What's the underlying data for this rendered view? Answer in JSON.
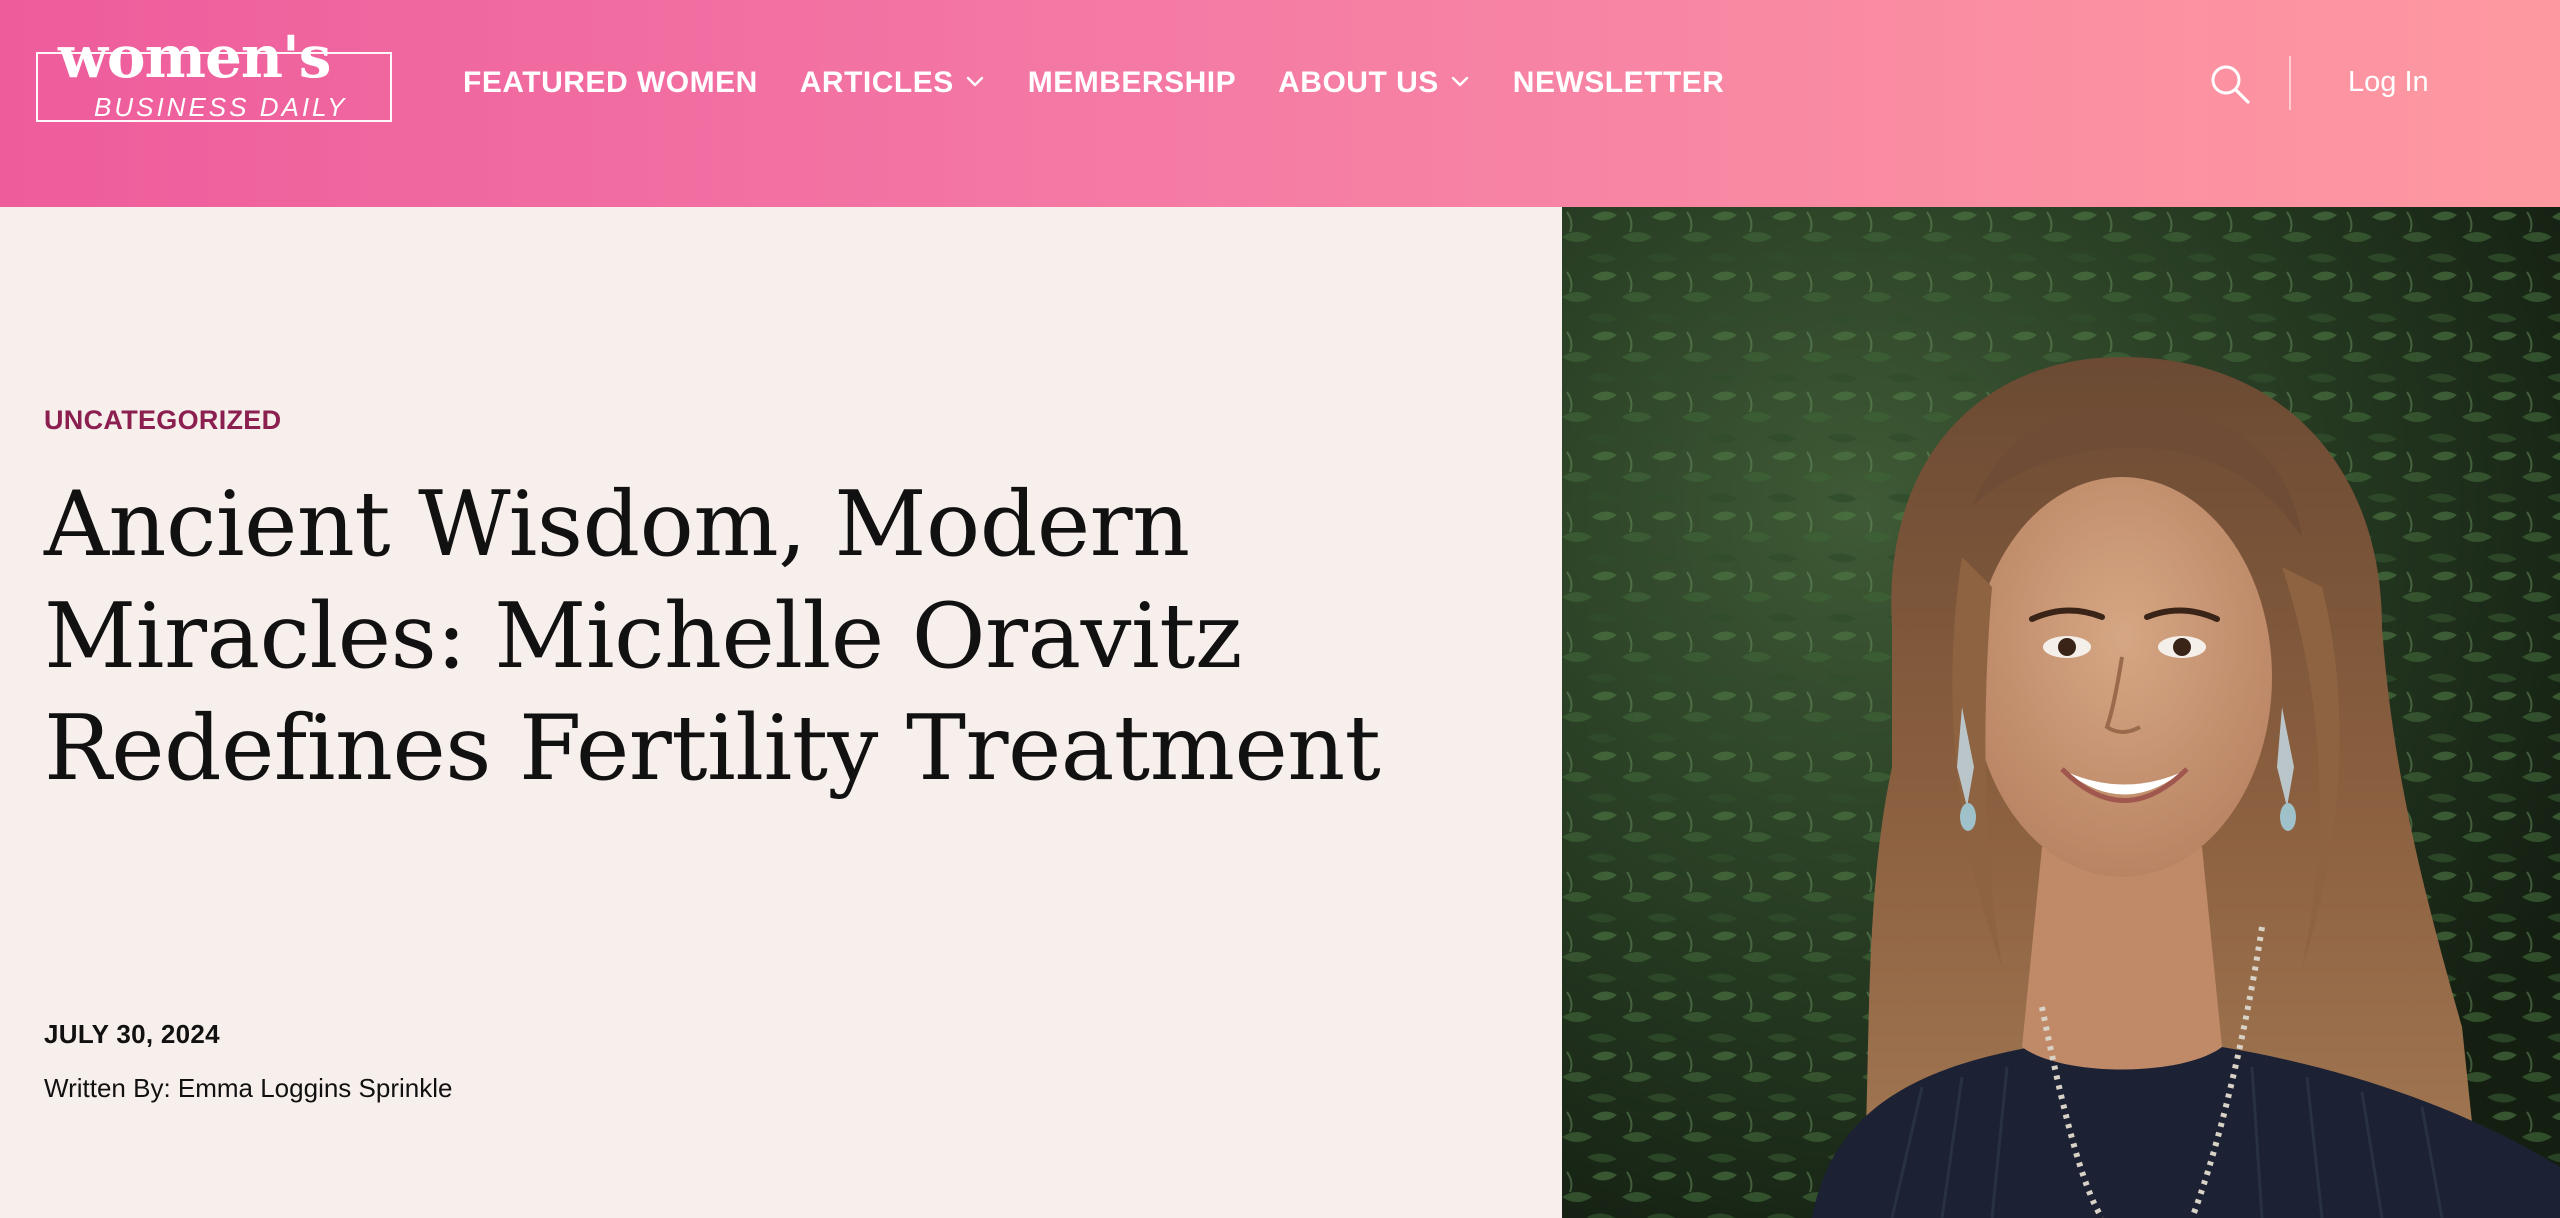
{
  "header": {
    "logo_top": "women's",
    "logo_bottom": "BUSINESS DAILY",
    "nav": [
      {
        "label": "FEATURED WOMEN",
        "has_dropdown": false
      },
      {
        "label": "ARTICLES",
        "has_dropdown": true
      },
      {
        "label": "MEMBERSHIP",
        "has_dropdown": false
      },
      {
        "label": "ABOUT US",
        "has_dropdown": true
      },
      {
        "label": "NEWSLETTER",
        "has_dropdown": false
      }
    ],
    "search_icon": "search-icon",
    "login_label": "Log In"
  },
  "article": {
    "category": "UNCATEGORIZED",
    "title": "Ancient Wisdom, Modern Miracles: Michelle Oravitz Redefines Fertility Treatment",
    "date": "JULY 30, 2024",
    "byline": "Written By: Emma Loggins Sprinkle"
  },
  "colors": {
    "header_gradient_start": "#ee5c9c",
    "header_gradient_end": "#fd98a0",
    "page_background": "#f7efeb",
    "category_color": "#8b1f4f",
    "title_color": "#111111"
  }
}
